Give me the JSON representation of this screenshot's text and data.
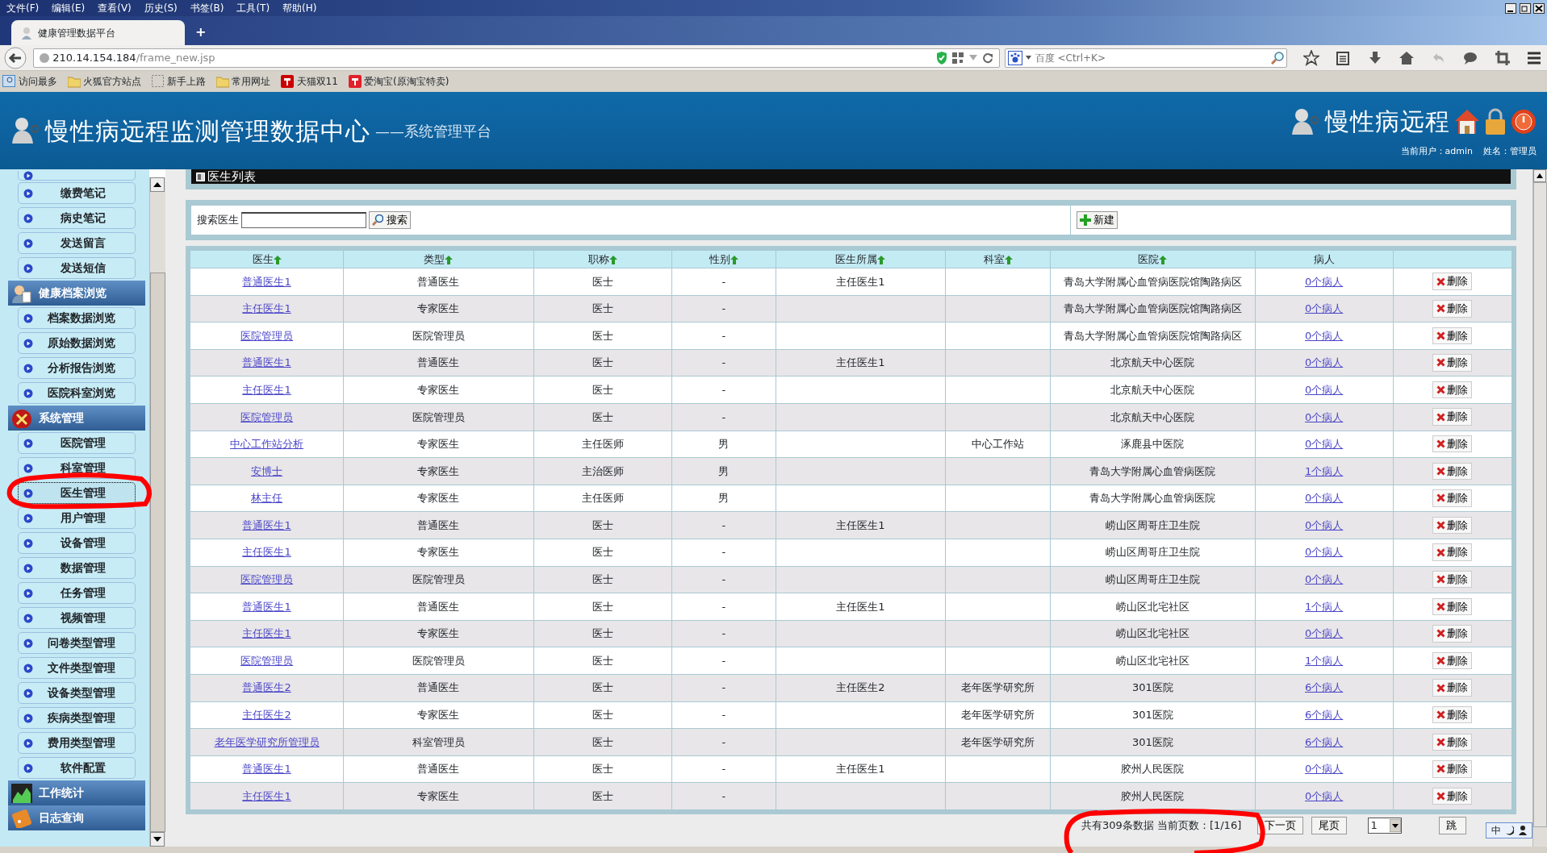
{
  "browser": {
    "menu": [
      "文件(F)",
      "编辑(E)",
      "查看(V)",
      "历史(S)",
      "书签(B)",
      "工具(T)",
      "帮助(H)"
    ],
    "tab": {
      "title": "健康管理数据平台",
      "selected": true
    },
    "new_tab": "+",
    "url_host": "210.14.154.184",
    "url_path": "/frame_new.jsp",
    "search": {
      "placeholder": "百度 <Ctrl+K>"
    },
    "bookmarks": [
      "访问最多",
      "火狐官方站点",
      "新手上路",
      "常用网址",
      "天猫双11",
      "爱淘宝(原淘宝特卖)"
    ]
  },
  "header": {
    "title": "慢性病远程监测管理数据中心",
    "subtitle": "——系统管理平台",
    "right_title": "慢性病远程",
    "user": "当前用户：admin",
    "name": "姓名：管理员"
  },
  "sidebar": [
    {
      "children": [
        {
          "selected": false
        },
        {
          "label": "缴费笔记",
          "selected": false
        },
        {
          "label": "病史笔记",
          "selected": false
        },
        {
          "label": "发送留言",
          "selected": false
        },
        {
          "label": "发送短信",
          "selected": false
        }
      ]
    },
    {
      "label": "健康档案浏览",
      "children": [
        {
          "label": "档案数据浏览",
          "selected": false
        },
        {
          "label": "原始数据浏览",
          "selected": false
        },
        {
          "label": "分析报告浏览",
          "selected": false
        },
        {
          "label": "医院科室浏览",
          "selected": false
        }
      ]
    },
    {
      "label": "系统管理",
      "children": [
        {
          "label": "医院管理",
          "selected": false
        },
        {
          "label": "科室管理",
          "selected": false
        },
        {
          "label": "医生管理",
          "selected": true
        },
        {
          "label": "用户管理",
          "selected": false
        },
        {
          "label": "设备管理",
          "selected": false
        },
        {
          "label": "数据管理",
          "selected": false
        },
        {
          "label": "任务管理",
          "selected": false
        },
        {
          "label": "视频管理",
          "selected": false
        },
        {
          "label": "问卷类型管理",
          "selected": false
        },
        {
          "label": "文件类型管理",
          "selected": false
        },
        {
          "label": "设备类型管理",
          "selected": false
        },
        {
          "label": "疾病类型管理",
          "selected": false
        },
        {
          "label": "费用类型管理",
          "selected": false
        },
        {
          "label": "软件配置",
          "selected": false
        }
      ]
    },
    {
      "label": "工作统计"
    },
    {
      "label": "日志查询"
    }
  ],
  "panel_title": "医生列表",
  "search": {
    "label": "搜索医生",
    "button": "搜索",
    "new_button": "新建"
  },
  "table": {
    "columns": [
      {
        "label": "医生",
        "sortable": true
      },
      {
        "label": "类型",
        "sortable": true
      },
      {
        "label": "职称",
        "sortable": true
      },
      {
        "label": "性别",
        "sortable": true
      },
      {
        "label": "医生所属",
        "sortable": true
      },
      {
        "label": "科室",
        "sortable": true
      },
      {
        "label": "医院",
        "sortable": true
      },
      {
        "label": "病人",
        "sortable": false
      }
    ],
    "rows": [
      {
        "doctor": "普通医生1",
        "type": "普通医生",
        "title": "医士",
        "gender": "-",
        "supervisor": "主任医生1",
        "hospital": "青岛大学附属心血管病医院馆陶路病区",
        "patients": "0个病人",
        "delete": "删除"
      },
      {
        "doctor": "主任医生1",
        "type": "专家医生",
        "title": "医士",
        "gender": "-",
        "hospital": "青岛大学附属心血管病医院馆陶路病区",
        "patients": "0个病人",
        "delete": "删除"
      },
      {
        "doctor": "医院管理员",
        "type": "医院管理员",
        "title": "医士",
        "gender": "-",
        "hospital": "青岛大学附属心血管病医院馆陶路病区",
        "patients": "0个病人",
        "delete": "删除"
      },
      {
        "doctor": "普通医生1",
        "type": "普通医生",
        "title": "医士",
        "gender": "-",
        "supervisor": "主任医生1",
        "hospital": "北京航天中心医院",
        "patients": "0个病人",
        "delete": "删除"
      },
      {
        "doctor": "主任医生1",
        "type": "专家医生",
        "title": "医士",
        "gender": "-",
        "hospital": "北京航天中心医院",
        "patients": "0个病人",
        "delete": "删除"
      },
      {
        "doctor": "医院管理员",
        "type": "医院管理员",
        "title": "医士",
        "gender": "-",
        "hospital": "北京航天中心医院",
        "patients": "0个病人",
        "delete": "删除"
      },
      {
        "doctor": "中心工作站分析",
        "type": "专家医生",
        "title": "主任医师",
        "gender": "男",
        "department": "中心工作站",
        "hospital": "涿鹿县中医院",
        "patients": "0个病人",
        "delete": "删除"
      },
      {
        "doctor": "安博士",
        "type": "专家医生",
        "title": "主治医师",
        "gender": "男",
        "hospital": "青岛大学附属心血管病医院",
        "patients": "1个病人",
        "delete": "删除"
      },
      {
        "doctor": "林主任",
        "type": "专家医生",
        "title": "主任医师",
        "gender": "男",
        "hospital": "青岛大学附属心血管病医院",
        "patients": "0个病人",
        "delete": "删除"
      },
      {
        "doctor": "普通医生1",
        "type": "普通医生",
        "title": "医士",
        "gender": "-",
        "supervisor": "主任医生1",
        "hospital": "崂山区周哥庄卫生院",
        "patients": "0个病人",
        "delete": "删除"
      },
      {
        "doctor": "主任医生1",
        "type": "专家医生",
        "title": "医士",
        "gender": "-",
        "hospital": "崂山区周哥庄卫生院",
        "patients": "0个病人",
        "delete": "删除"
      },
      {
        "doctor": "医院管理员",
        "type": "医院管理员",
        "title": "医士",
        "gender": "-",
        "hospital": "崂山区周哥庄卫生院",
        "patients": "0个病人",
        "delete": "删除"
      },
      {
        "doctor": "普通医生1",
        "type": "普通医生",
        "title": "医士",
        "gender": "-",
        "supervisor": "主任医生1",
        "hospital": "崂山区北宅社区",
        "patients": "1个病人",
        "delete": "删除"
      },
      {
        "doctor": "主任医生1",
        "type": "专家医生",
        "title": "医士",
        "gender": "-",
        "hospital": "崂山区北宅社区",
        "patients": "0个病人",
        "delete": "删除"
      },
      {
        "doctor": "医院管理员",
        "type": "医院管理员",
        "title": "医士",
        "gender": "-",
        "hospital": "崂山区北宅社区",
        "patients": "1个病人",
        "delete": "删除"
      },
      {
        "doctor": "普通医生2",
        "type": "普通医生",
        "title": "医士",
        "gender": "-",
        "supervisor": "主任医生2",
        "department": "老年医学研究所",
        "hospital": "301医院",
        "patients": "6个病人",
        "delete": "删除"
      },
      {
        "doctor": "主任医生2",
        "type": "专家医生",
        "title": "医士",
        "gender": "-",
        "department": "老年医学研究所",
        "hospital": "301医院",
        "patients": "6个病人",
        "delete": "删除"
      },
      {
        "doctor": "老年医学研究所管理员",
        "type": "科室管理员",
        "title": "医士",
        "gender": "-",
        "department": "老年医学研究所",
        "hospital": "301医院",
        "patients": "6个病人",
        "delete": "删除"
      },
      {
        "doctor": "普通医生1",
        "type": "普通医生",
        "title": "医士",
        "gender": "-",
        "supervisor": "主任医生1",
        "hospital": "胶州人民医院",
        "patients": "0个病人",
        "delete": "删除"
      },
      {
        "doctor": "主任医生1",
        "type": "专家医生",
        "title": "医士",
        "gender": "-",
        "hospital": "胶州人民医院",
        "patients": "0个病人",
        "delete": "删除"
      }
    ]
  },
  "pagination": {
    "summary": "共有309条数据 当前页数：[1/16]",
    "next": "下一页",
    "last": "尾页",
    "page_select": "1",
    "jump": "跳"
  },
  "ime": {
    "label": "中"
  }
}
